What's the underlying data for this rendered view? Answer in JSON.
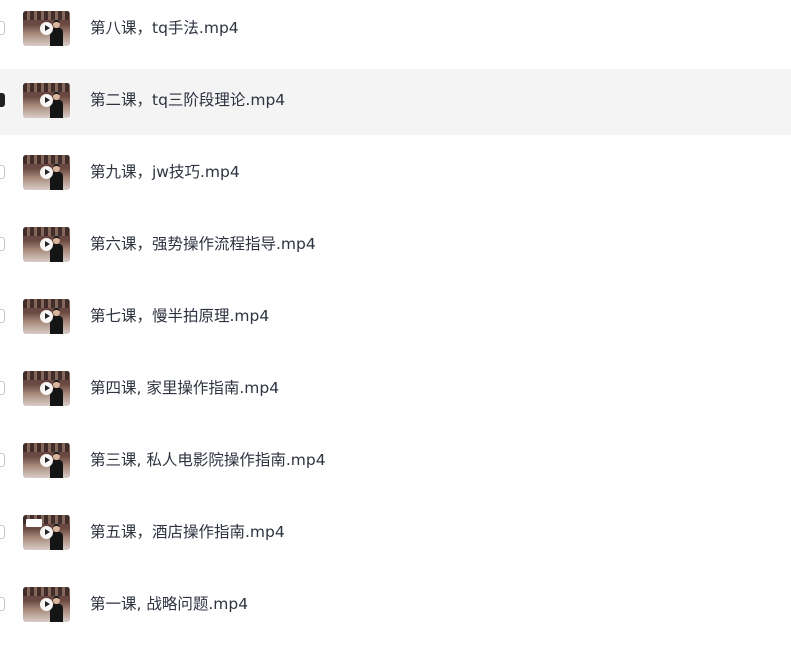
{
  "files": [
    {
      "name": "第八课，tq手法.mp4",
      "selected": false,
      "checked": false
    },
    {
      "name": "第二课，tq三阶段理论.mp4",
      "selected": true,
      "checked": true
    },
    {
      "name": "第九课，jw技巧.mp4",
      "selected": false,
      "checked": false
    },
    {
      "name": "第六课，强势操作流程指导.mp4",
      "selected": false,
      "checked": false
    },
    {
      "name": "第七课，慢半拍原理.mp4",
      "selected": false,
      "checked": false
    },
    {
      "name": "第四课, 家里操作指南.mp4",
      "selected": false,
      "checked": false
    },
    {
      "name": "第三课, 私人电影院操作指南.mp4",
      "selected": false,
      "checked": false
    },
    {
      "name": "第五课，酒店操作指南.mp4",
      "selected": false,
      "checked": false
    },
    {
      "name": "第一课, 战略问题.mp4",
      "selected": false,
      "checked": false
    }
  ],
  "thumbnail_icon": "video-thumbnail-icon",
  "play_icon": "play-icon",
  "colors": {
    "selected_row_bg": "#f4f4f4",
    "text": "#2e3340",
    "checkbox_checked": "#1f1f1f"
  }
}
